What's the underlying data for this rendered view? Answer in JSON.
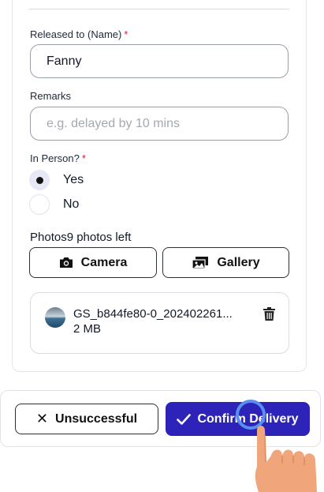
{
  "form": {
    "released_to": {
      "label": "Released to (Name)",
      "required_mark": "*",
      "value": "Fanny"
    },
    "remarks": {
      "label": "Remarks",
      "placeholder": "e.g. delayed by 10 mins"
    },
    "in_person": {
      "label": "In Person?",
      "required_mark": "*",
      "options": [
        {
          "label": "Yes",
          "selected": true
        },
        {
          "label": "No",
          "selected": false
        }
      ]
    },
    "photos": {
      "title": "Photos",
      "remaining": "9 photos left",
      "camera_label": "Camera",
      "gallery_label": "Gallery",
      "files": [
        {
          "name": "GS_b844fe80-0_202402261...",
          "size": "2 MB"
        }
      ]
    }
  },
  "footer": {
    "unsuccessful_label": "Unsuccessful",
    "confirm_label": "Confirm Delivery"
  },
  "colors": {
    "primary": "#2d23b9",
    "required": "#d21f3c",
    "tap_indicator": "#5a8ff0",
    "hand": "#f0a67a"
  },
  "icons": [
    "camera-icon",
    "gallery-icon",
    "trash-icon",
    "close-x-icon",
    "checkmark-icon"
  ]
}
